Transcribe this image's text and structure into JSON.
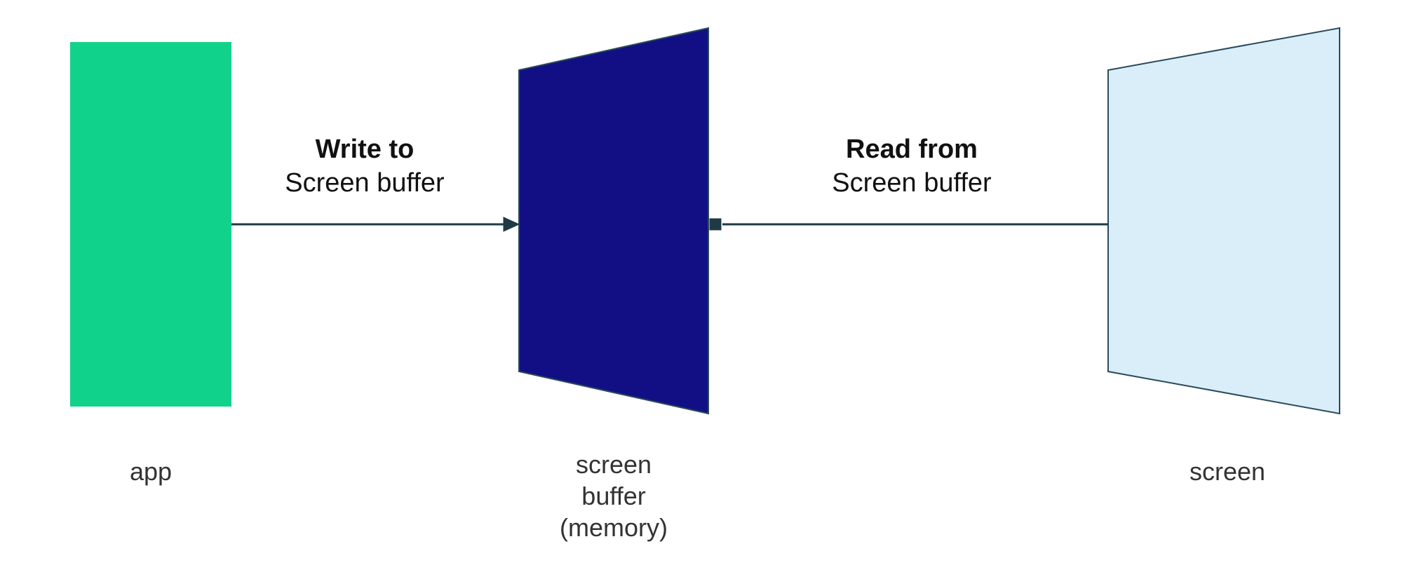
{
  "nodes": {
    "app": {
      "label": "app",
      "fill": "#11D28B"
    },
    "buffer": {
      "label_line1": "screen",
      "label_line2": "buffer",
      "label_line3": "(memory)",
      "fill": "#120F85",
      "stroke": "#2A4A5A"
    },
    "screen": {
      "label": "screen",
      "fill": "#D9EEF8",
      "stroke": "#2A4A5A"
    }
  },
  "arrows": {
    "write": {
      "bold": "Write to",
      "sub": "Screen buffer",
      "stroke": "#1F3A44"
    },
    "read": {
      "bold": "Read from",
      "sub": "Screen buffer",
      "stroke": "#1F3A44"
    }
  }
}
